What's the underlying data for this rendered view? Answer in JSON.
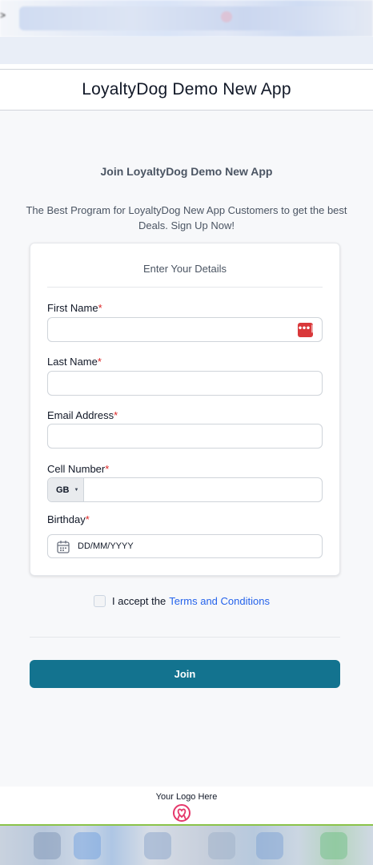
{
  "browser": {
    "edge_glyph": ">"
  },
  "header": {
    "title": "LoyaltyDog Demo New App"
  },
  "intro": {
    "title": "Join LoyaltyDog Demo New App",
    "subtitle": "The Best Program for LoyaltyDog New App Customers to get the best Deals. Sign Up Now!"
  },
  "form": {
    "heading": "Enter Your Details",
    "required_mark": "*",
    "first_name": {
      "label": "First Name",
      "value": ""
    },
    "last_name": {
      "label": "Last Name",
      "value": ""
    },
    "email": {
      "label": "Email Address",
      "value": ""
    },
    "cell": {
      "label": "Cell Number",
      "country_code": "GB",
      "value": ""
    },
    "birthday": {
      "label": "Birthday",
      "placeholder": "DD/MM/YYYY"
    },
    "password_manager_icon": "password-manager-icon"
  },
  "terms": {
    "text": "I accept the",
    "link": "Terms and Conditions",
    "checked": false
  },
  "actions": {
    "join_label": "Join"
  },
  "footer": {
    "logo_text": "Your Logo Here",
    "logo_icon": "heart-ribbon-icon"
  },
  "colors": {
    "primary": "#13738f",
    "required": "#dc2626",
    "link": "#2563eb",
    "footer_accent": "#8bc34a"
  }
}
